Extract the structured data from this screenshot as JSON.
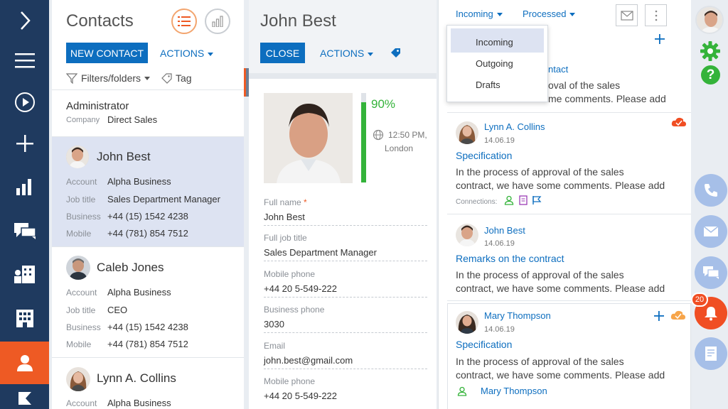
{
  "contacts": {
    "title": "Contacts",
    "new_contact": "NEW CONTACT",
    "actions": "ACTIONS",
    "filters": "Filters/folders",
    "tag": "Tag",
    "admin": {
      "name": "Administrator",
      "company_label": "Company",
      "company_value": "Direct Sales"
    },
    "cards": [
      {
        "name": "John Best",
        "fields": [
          {
            "label": "Account",
            "value": "Alpha Business"
          },
          {
            "label": "Job title",
            "value": "Sales Department Manager"
          },
          {
            "label": "Business",
            "value": "+44 (15) 1542 4238"
          },
          {
            "label": "Mobile",
            "value": "+44 (781) 854 7512"
          }
        ]
      },
      {
        "name": "Caleb Jones",
        "fields": [
          {
            "label": "Account",
            "value": "Alpha Business"
          },
          {
            "label": "Job title",
            "value": "CEO"
          },
          {
            "label": "Business",
            "value": "+44 (15) 1542 4238"
          },
          {
            "label": "Mobile",
            "value": "+44 (781) 854 7512"
          }
        ]
      },
      {
        "name": "Lynn A. Collins",
        "fields": [
          {
            "label": "Account",
            "value": "Alpha Business"
          }
        ]
      }
    ]
  },
  "detail": {
    "title": "John Best",
    "close": "CLOSE",
    "actions": "ACTIONS",
    "completeness": "90%",
    "completeness_value": 0.9,
    "time": "12:50 PM,",
    "location": "London",
    "fields": [
      {
        "label": "Full name",
        "required": "*",
        "value": "John Best"
      },
      {
        "label": "Full job title",
        "value": "Sales Department Manager"
      },
      {
        "label": "Mobile phone",
        "value": "+44 20 5-549-222"
      },
      {
        "label": "Business phone",
        "value": "3030"
      },
      {
        "label": "Email",
        "value": "john.best@gmail.com"
      },
      {
        "label": "Mobile phone",
        "value": "+44 20 5-549-222"
      }
    ]
  },
  "feed": {
    "tab_incoming": "Incoming",
    "tab_processed": "Processed",
    "dropdown": [
      "Incoming",
      "Outgoing",
      "Drafts"
    ],
    "partial_1": "ntact",
    "partial_2": "oval of the sales",
    "partial_3": "me comments. Please add",
    "items": [
      {
        "author": "Lynn A. Collins",
        "date": "14.06.19",
        "title": "Specification",
        "text_1": "In the process of approval of the sales",
        "text_2": "contract, we have some comments. Please add",
        "connections": "Connections:"
      },
      {
        "author": "John Best",
        "date": "14.06.19",
        "title": "Remarks on the contract",
        "text_1": "In the process of approval of the sales",
        "text_2": "contract, we have some comments. Please add"
      },
      {
        "author": "Mary Thompson",
        "date": "14.06.19",
        "title": "Specification",
        "text_1": "In the process of approval of the sales",
        "text_2": "contract, we have some comments. Please add",
        "assignee": "Mary Thompson"
      }
    ]
  },
  "rail": {
    "notifications": "20"
  },
  "colors": {
    "nav": "#1f3a5f",
    "active": "#ee5a24",
    "accent": "#0d6ebf",
    "green": "#34b33a",
    "rail_btn": "#a6bfe8",
    "bell": "#f04e23"
  }
}
